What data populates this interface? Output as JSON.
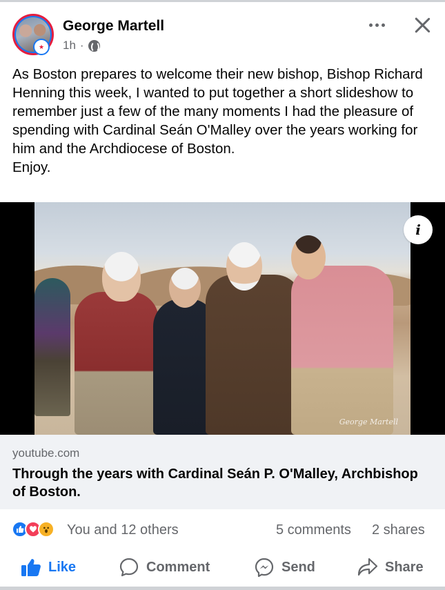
{
  "post": {
    "author": "George Martell",
    "time": "1h",
    "separator": "·",
    "text": "As Boston prepares to welcome their new bishop, Bishop Richard Henning this week, I wanted to put together a short slideshow to remember just a few of the many moments I had the pleasure of spending with Cardinal Seán O'Malley over the years working for him and the Archdiocese of Boston.\nEnjoy."
  },
  "media": {
    "watermark": "George Martell",
    "info_glyph": "i"
  },
  "link_preview": {
    "domain": "youtube.com",
    "title": "Through the years with Cardinal Seán P. O'Malley, Archbishop of Boston."
  },
  "stats": {
    "reactions_text": "You and 12 others",
    "comments": "5 comments",
    "shares": "2 shares",
    "reaction_icons": [
      "like-icon",
      "love-icon",
      "wow-icon"
    ]
  },
  "actions": {
    "like": "Like",
    "comment": "Comment",
    "send": "Send",
    "share": "Share"
  },
  "colors": {
    "accent": "#1877f2",
    "secondary_text": "#65676b",
    "link_bg": "#f0f2f5"
  }
}
